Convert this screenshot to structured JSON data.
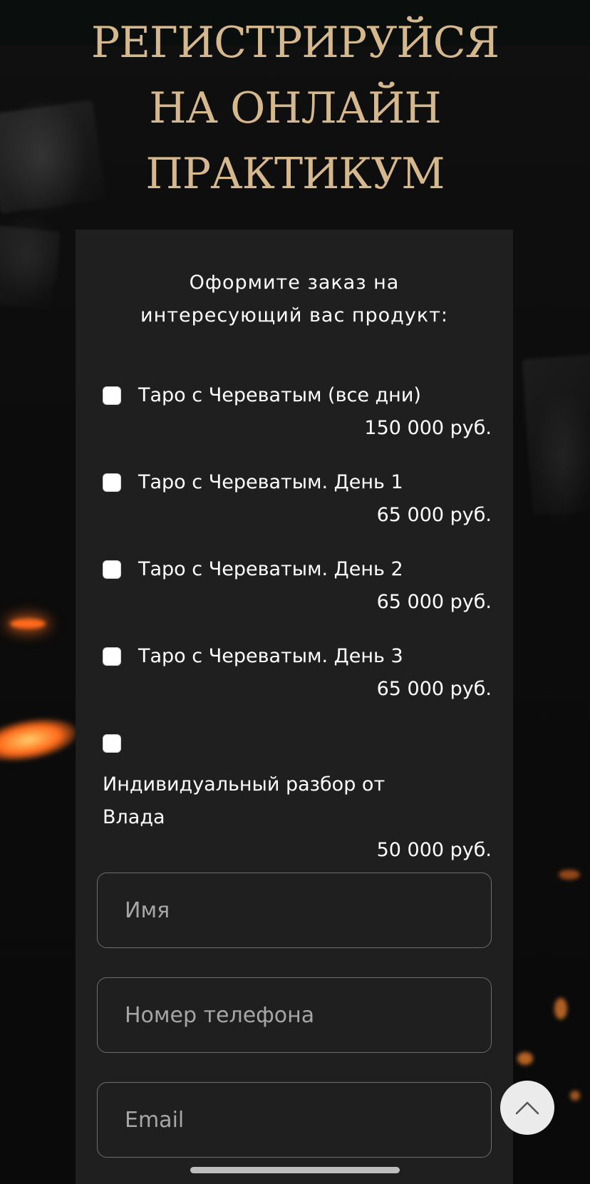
{
  "header": {
    "title": "РЕГИСТРИРУЙСЯ\nНА ОНЛАЙН\nПРАКТИКУМ"
  },
  "form": {
    "heading": "Оформите заказ на\nинтересующий вас продукт:",
    "options": [
      {
        "label": "Таро с Череватым (все дни)",
        "price": "150 000 руб.",
        "checked": false
      },
      {
        "label": "Таро с Череватым. День 1",
        "price": "65 000 руб.",
        "checked": false
      },
      {
        "label": "Таро с Череватым. День 2",
        "price": "65 000 руб.",
        "checked": false
      },
      {
        "label": "Таро с Череватым. День 3",
        "price": "65 000 руб.",
        "checked": false
      },
      {
        "label": "Индивидуальный разбор от Влада",
        "price": "50 000 руб.",
        "checked": false
      }
    ],
    "fields": {
      "name_placeholder": "Имя",
      "phone_placeholder": "Номер телефона",
      "email_placeholder": "Email"
    }
  },
  "colors": {
    "title_gold": "#d6b88e",
    "card_background": "#1f1f1f",
    "page_background": "#0d0d0d"
  },
  "icons": {
    "scroll_top": "chevron-up-icon"
  }
}
